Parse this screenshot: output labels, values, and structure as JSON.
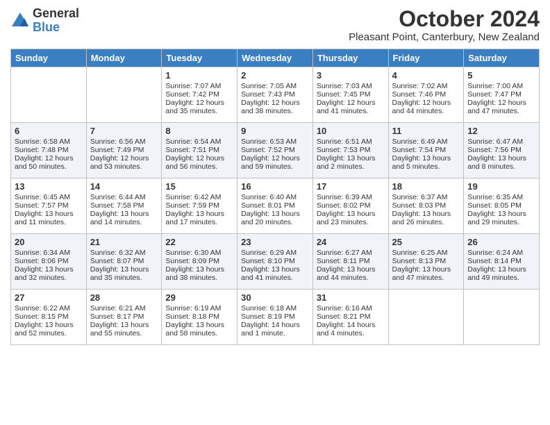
{
  "logo": {
    "general": "General",
    "blue": "Blue"
  },
  "title": "October 2024",
  "subtitle": "Pleasant Point, Canterbury, New Zealand",
  "days_of_week": [
    "Sunday",
    "Monday",
    "Tuesday",
    "Wednesday",
    "Thursday",
    "Friday",
    "Saturday"
  ],
  "weeks": [
    [
      {
        "day": "",
        "info": ""
      },
      {
        "day": "",
        "info": ""
      },
      {
        "day": "1",
        "info": "Sunrise: 7:07 AM\nSunset: 7:42 PM\nDaylight: 12 hours and 35 minutes."
      },
      {
        "day": "2",
        "info": "Sunrise: 7:05 AM\nSunset: 7:43 PM\nDaylight: 12 hours and 38 minutes."
      },
      {
        "day": "3",
        "info": "Sunrise: 7:03 AM\nSunset: 7:45 PM\nDaylight: 12 hours and 41 minutes."
      },
      {
        "day": "4",
        "info": "Sunrise: 7:02 AM\nSunset: 7:46 PM\nDaylight: 12 hours and 44 minutes."
      },
      {
        "day": "5",
        "info": "Sunrise: 7:00 AM\nSunset: 7:47 PM\nDaylight: 12 hours and 47 minutes."
      }
    ],
    [
      {
        "day": "6",
        "info": "Sunrise: 6:58 AM\nSunset: 7:48 PM\nDaylight: 12 hours and 50 minutes."
      },
      {
        "day": "7",
        "info": "Sunrise: 6:56 AM\nSunset: 7:49 PM\nDaylight: 12 hours and 53 minutes."
      },
      {
        "day": "8",
        "info": "Sunrise: 6:54 AM\nSunset: 7:51 PM\nDaylight: 12 hours and 56 minutes."
      },
      {
        "day": "9",
        "info": "Sunrise: 6:53 AM\nSunset: 7:52 PM\nDaylight: 12 hours and 59 minutes."
      },
      {
        "day": "10",
        "info": "Sunrise: 6:51 AM\nSunset: 7:53 PM\nDaylight: 13 hours and 2 minutes."
      },
      {
        "day": "11",
        "info": "Sunrise: 6:49 AM\nSunset: 7:54 PM\nDaylight: 13 hours and 5 minutes."
      },
      {
        "day": "12",
        "info": "Sunrise: 6:47 AM\nSunset: 7:56 PM\nDaylight: 13 hours and 8 minutes."
      }
    ],
    [
      {
        "day": "13",
        "info": "Sunrise: 6:45 AM\nSunset: 7:57 PM\nDaylight: 13 hours and 11 minutes."
      },
      {
        "day": "14",
        "info": "Sunrise: 6:44 AM\nSunset: 7:58 PM\nDaylight: 13 hours and 14 minutes."
      },
      {
        "day": "15",
        "info": "Sunrise: 6:42 AM\nSunset: 7:59 PM\nDaylight: 13 hours and 17 minutes."
      },
      {
        "day": "16",
        "info": "Sunrise: 6:40 AM\nSunset: 8:01 PM\nDaylight: 13 hours and 20 minutes."
      },
      {
        "day": "17",
        "info": "Sunrise: 6:39 AM\nSunset: 8:02 PM\nDaylight: 13 hours and 23 minutes."
      },
      {
        "day": "18",
        "info": "Sunrise: 6:37 AM\nSunset: 8:03 PM\nDaylight: 13 hours and 26 minutes."
      },
      {
        "day": "19",
        "info": "Sunrise: 6:35 AM\nSunset: 8:05 PM\nDaylight: 13 hours and 29 minutes."
      }
    ],
    [
      {
        "day": "20",
        "info": "Sunrise: 6:34 AM\nSunset: 8:06 PM\nDaylight: 13 hours and 32 minutes."
      },
      {
        "day": "21",
        "info": "Sunrise: 6:32 AM\nSunset: 8:07 PM\nDaylight: 13 hours and 35 minutes."
      },
      {
        "day": "22",
        "info": "Sunrise: 6:30 AM\nSunset: 8:09 PM\nDaylight: 13 hours and 38 minutes."
      },
      {
        "day": "23",
        "info": "Sunrise: 6:29 AM\nSunset: 8:10 PM\nDaylight: 13 hours and 41 minutes."
      },
      {
        "day": "24",
        "info": "Sunrise: 6:27 AM\nSunset: 8:11 PM\nDaylight: 13 hours and 44 minutes."
      },
      {
        "day": "25",
        "info": "Sunrise: 6:25 AM\nSunset: 8:13 PM\nDaylight: 13 hours and 47 minutes."
      },
      {
        "day": "26",
        "info": "Sunrise: 6:24 AM\nSunset: 8:14 PM\nDaylight: 13 hours and 49 minutes."
      }
    ],
    [
      {
        "day": "27",
        "info": "Sunrise: 6:22 AM\nSunset: 8:15 PM\nDaylight: 13 hours and 52 minutes."
      },
      {
        "day": "28",
        "info": "Sunrise: 6:21 AM\nSunset: 8:17 PM\nDaylight: 13 hours and 55 minutes."
      },
      {
        "day": "29",
        "info": "Sunrise: 6:19 AM\nSunset: 8:18 PM\nDaylight: 13 hours and 58 minutes."
      },
      {
        "day": "30",
        "info": "Sunrise: 6:18 AM\nSunset: 8:19 PM\nDaylight: 14 hours and 1 minute."
      },
      {
        "day": "31",
        "info": "Sunrise: 6:16 AM\nSunset: 8:21 PM\nDaylight: 14 hours and 4 minutes."
      },
      {
        "day": "",
        "info": ""
      },
      {
        "day": "",
        "info": ""
      }
    ]
  ]
}
